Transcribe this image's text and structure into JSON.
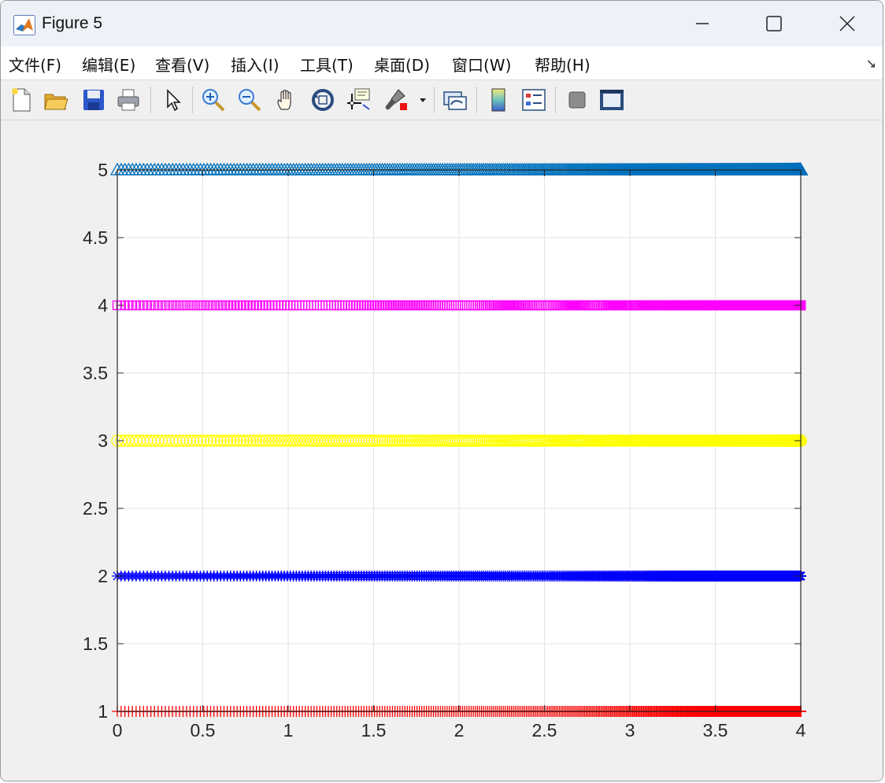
{
  "window": {
    "title": "Figure 5",
    "controls": [
      "minimize-icon",
      "maximize-icon",
      "close-icon"
    ]
  },
  "menu": {
    "items": [
      "文件(F)",
      "编辑(E)",
      "查看(V)",
      "插入(I)",
      "工具(T)",
      "桌面(D)",
      "窗口(W)",
      "帮助(H)"
    ],
    "overflow_icon": "dock-arrow-icon"
  },
  "toolbar": {
    "icons": [
      "new-figure-icon",
      "open-file-icon",
      "save-icon",
      "print-icon",
      "edit-plot-icon",
      "zoom-in-icon",
      "zoom-out-icon",
      "pan-icon",
      "rotate-3d-icon",
      "data-cursor-icon",
      "brush-icon",
      "brush-dropdown-icon",
      "link-plot-icon",
      "insert-colorbar-icon",
      "insert-legend-icon",
      "hide-plot-tools-icon",
      "show-plot-tools-icon"
    ]
  },
  "chart_data": {
    "type": "scatter",
    "title": "",
    "xlabel": "",
    "ylabel": "",
    "xlim": [
      0,
      4
    ],
    "ylim": [
      1,
      5
    ],
    "xticks": [
      "0",
      "0.5",
      "1",
      "1.5",
      "2",
      "2.5",
      "3",
      "3.5",
      "4"
    ],
    "yticks": [
      "1",
      "1.5",
      "2",
      "2.5",
      "3",
      "3.5",
      "4",
      "4.5",
      "5"
    ],
    "grid": true,
    "x_description": "x = sqrt(linspace(0,16,N)) style spacing: markers sparse near 0.5, dense toward 4",
    "series": [
      {
        "y": 1,
        "marker": "+",
        "color": "#ff0000"
      },
      {
        "y": 2,
        "marker": "*",
        "color": "#0000ff"
      },
      {
        "y": 3,
        "marker": "o",
        "color": "#ffff00"
      },
      {
        "y": 4,
        "marker": "square",
        "color": "#ff00ff"
      },
      {
        "y": 5,
        "marker": "^",
        "color": "#0072bd"
      }
    ]
  }
}
